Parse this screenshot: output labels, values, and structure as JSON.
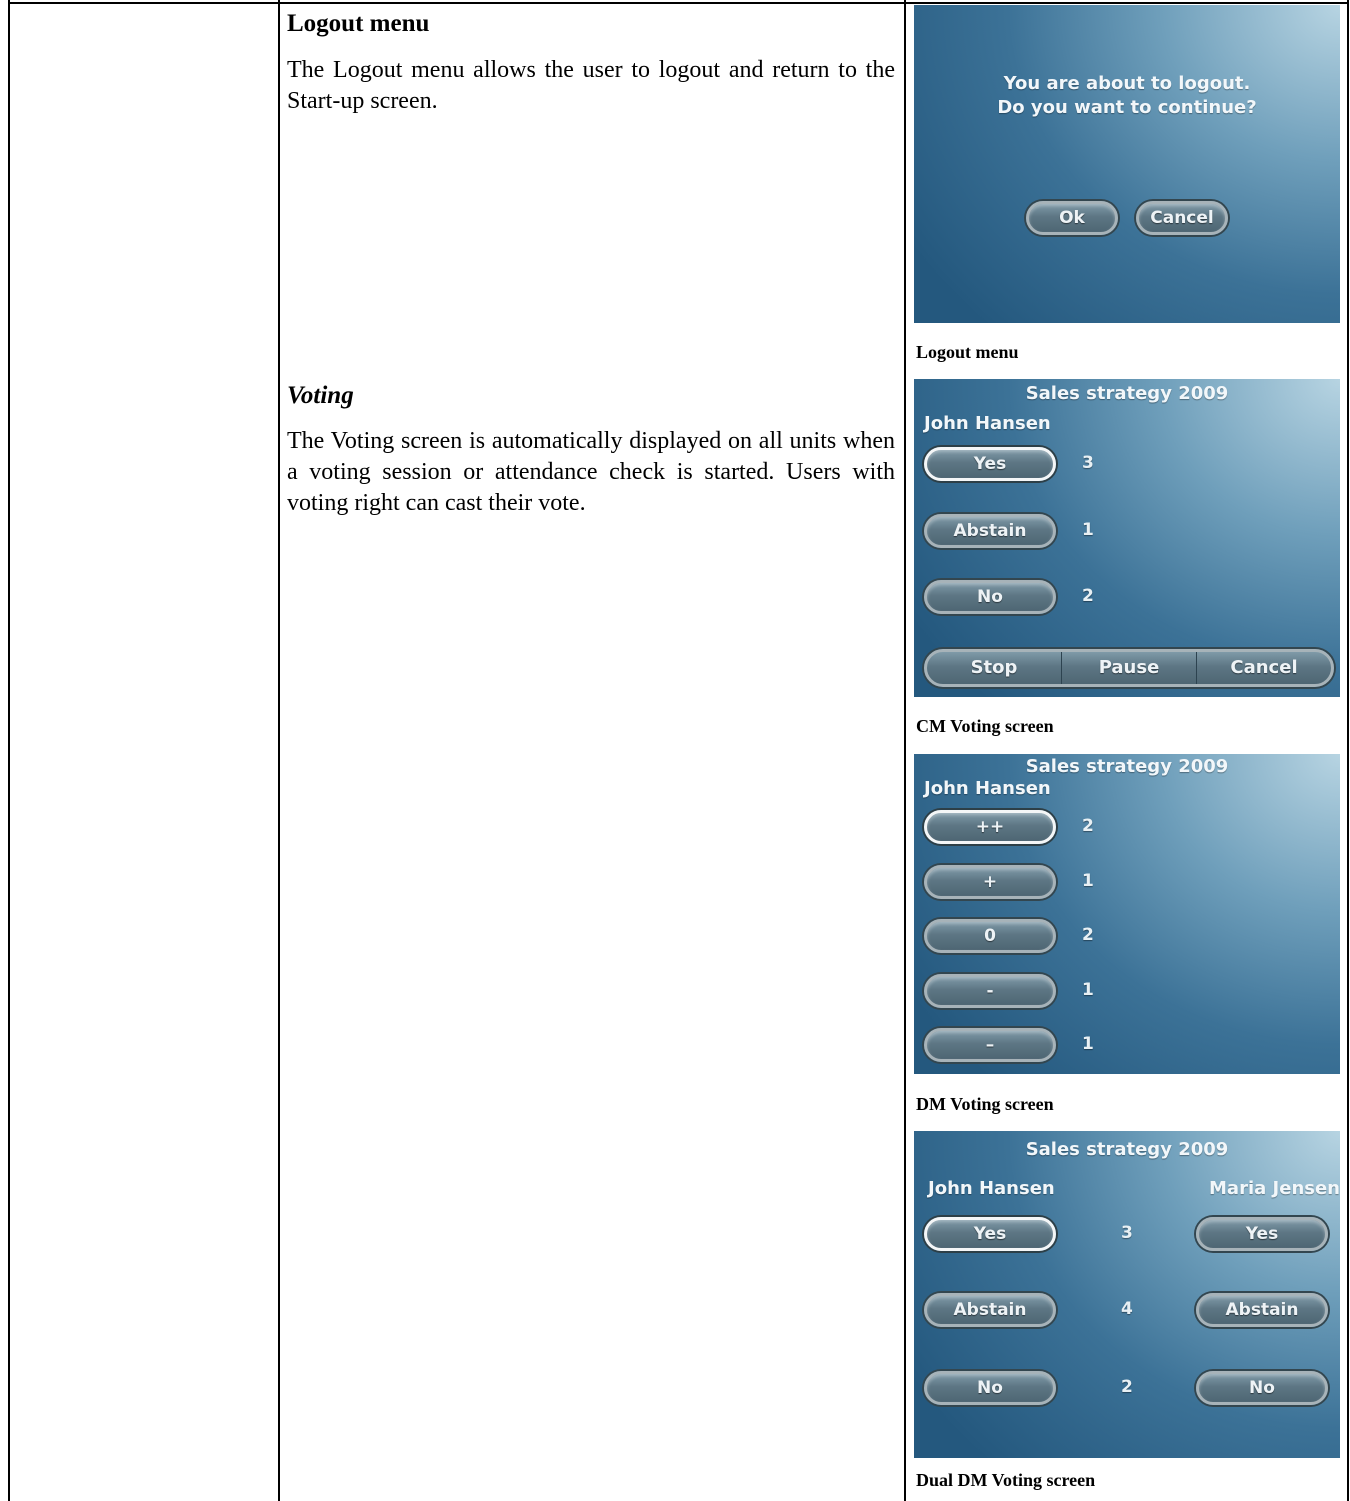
{
  "logout": {
    "title": "Logout menu",
    "body": "The Logout menu allows the user to logout and return to the Start-up screen.",
    "screen": {
      "line1": "You are about to logout.",
      "line2": "Do you want to continue?",
      "ok_label": "Ok",
      "cancel_label": "Cancel"
    },
    "caption": "Logout menu"
  },
  "voting": {
    "title": "Voting",
    "body": "The Voting screen is automatically displayed on all units when a voting session or attendance check is started. Users with voting right can cast their vote."
  },
  "cm_screen": {
    "title": "Sales strategy 2009",
    "user": "John Hansen",
    "options": [
      {
        "label": "Yes",
        "count": "3",
        "selected": true
      },
      {
        "label": "Abstain",
        "count": "1",
        "selected": false
      },
      {
        "label": "No",
        "count": "2",
        "selected": false
      }
    ],
    "controls": [
      "Stop",
      "Pause",
      "Cancel"
    ],
    "caption": "CM Voting screen"
  },
  "dm_screen": {
    "title": "Sales strategy 2009",
    "user": "John Hansen",
    "options": [
      {
        "label": "++",
        "count": "2",
        "selected": true
      },
      {
        "label": "+",
        "count": "1",
        "selected": false
      },
      {
        "label": "0",
        "count": "2",
        "selected": false
      },
      {
        "label": "-",
        "count": "1",
        "selected": false
      },
      {
        "label": "–",
        "count": "1",
        "selected": false
      }
    ],
    "caption": "DM Voting screen"
  },
  "dual_screen": {
    "title": "Sales strategy 2009",
    "user_left": "John Hansen",
    "user_right": "Maria Jensen",
    "options": [
      {
        "label": "Yes",
        "count": "3",
        "left_selected": true
      },
      {
        "label": "Abstain",
        "count": "4",
        "left_selected": false
      },
      {
        "label": "No",
        "count": "2",
        "left_selected": false
      }
    ],
    "caption": "Dual DM Voting screen"
  },
  "colors": {
    "screen_dark": "#24587e",
    "screen_light": "#b7d4e2",
    "button": "#5d7684"
  },
  "icons": []
}
